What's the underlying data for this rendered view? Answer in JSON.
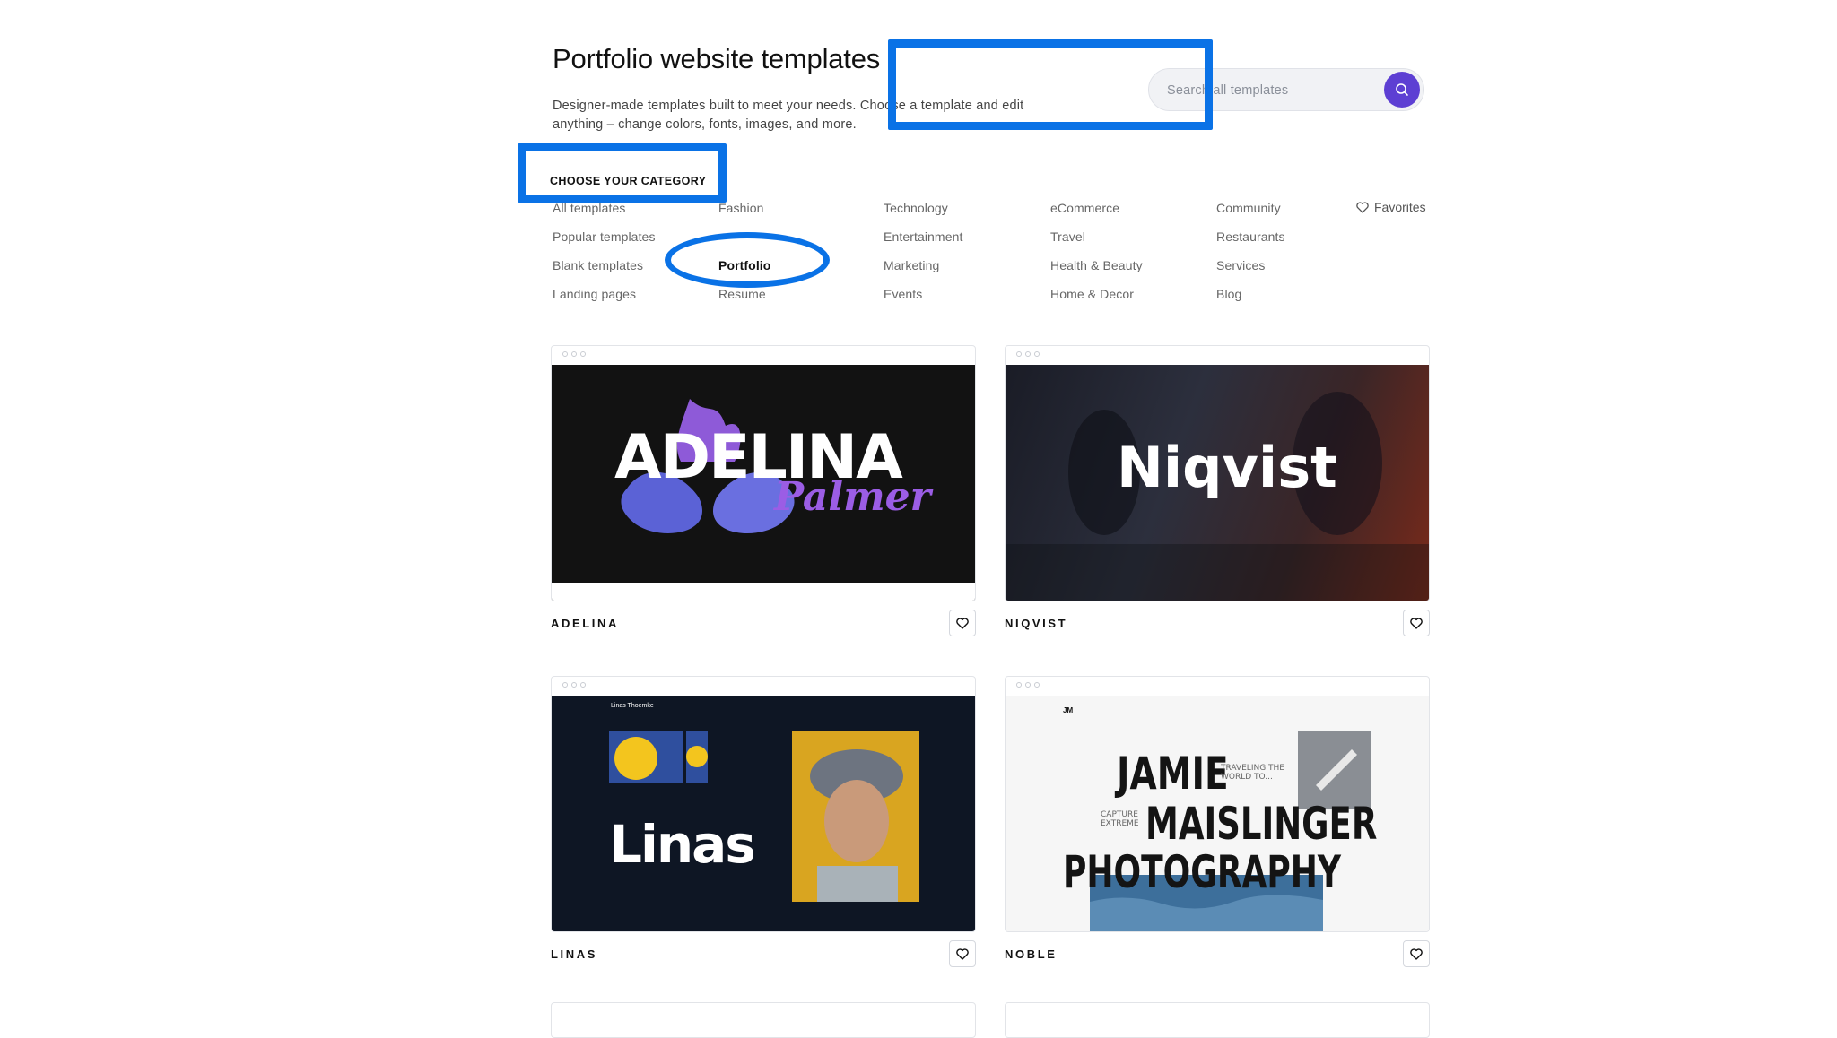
{
  "header": {
    "title": "Portfolio website templates",
    "description": "Designer-made templates built to meet your needs. Choose a template and edit anything – change colors, fonts, images, and more."
  },
  "search": {
    "placeholder": "Search all templates",
    "value": ""
  },
  "categories": {
    "heading": "CHOOSE YOUR CATEGORY",
    "columns": [
      [
        "All templates",
        "Popular templates",
        "Blank templates",
        "Landing pages"
      ],
      [
        "Fashion",
        "Portfolio",
        "Resume"
      ],
      [
        "Technology",
        "Entertainment",
        "Marketing",
        "Events"
      ],
      [
        "eCommerce",
        "Travel",
        "Health & Beauty",
        "Home & Decor"
      ],
      [
        "Community",
        "Restaurants",
        "Services",
        "Blog"
      ]
    ],
    "selected": "Portfolio",
    "favorites_label": "Favorites"
  },
  "templates": [
    {
      "name": "ADELINA",
      "preview_title": "ADELINA",
      "preview_subtitle": "Palmer"
    },
    {
      "name": "NIQVIST",
      "preview_title": "Niqvist"
    },
    {
      "name": "LINAS",
      "preview_title": "Linas",
      "preview_header": "Linas Thoemke"
    },
    {
      "name": "NOBLE",
      "preview_lines": [
        "JAMIE",
        "MAISLINGER",
        "PHOTOGRAPHY"
      ],
      "preview_logo": "JM",
      "preview_tag1": "TRAVELING THE WORLD TO...",
      "preview_tag2": "CAPTURE EXTREME"
    }
  ],
  "colors": {
    "accent": "#5d3fd3",
    "annotation": "#0a72e6"
  },
  "icons": {
    "search": "search-icon",
    "heart": "heart-icon"
  }
}
